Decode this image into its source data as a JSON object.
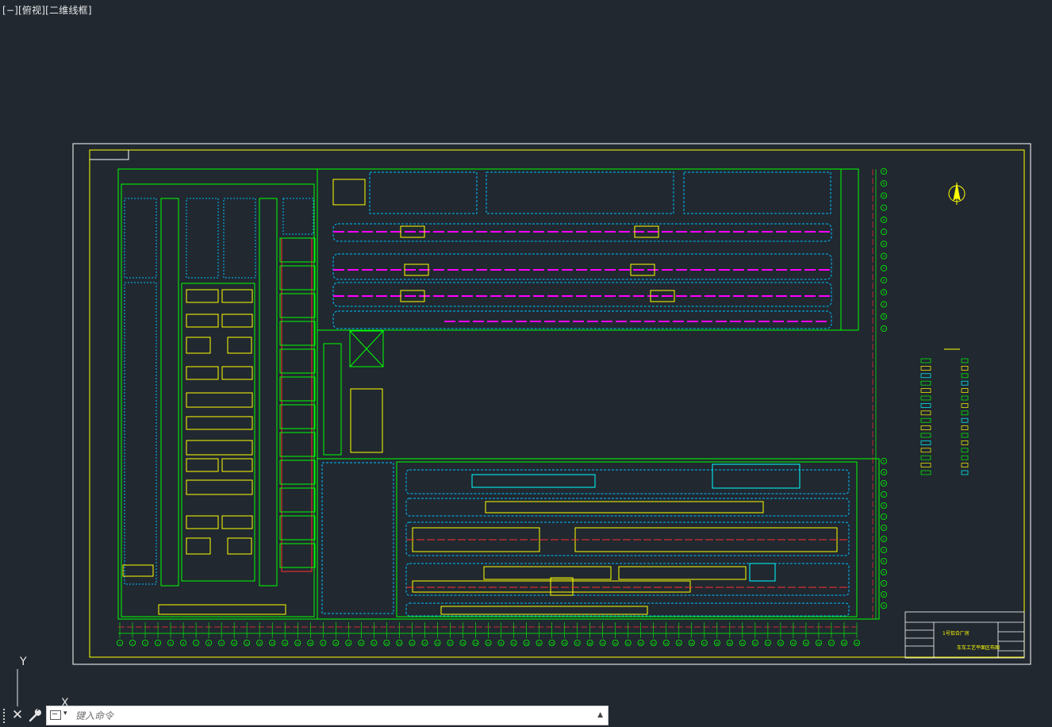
{
  "viewport": {
    "label": "[−][俯视][二维线框]"
  },
  "ucs": {
    "x_label": "X",
    "y_label": "Y"
  },
  "command_line": {
    "placeholder": "键入命令",
    "close_glyph": "✕",
    "up_glyph": "▲",
    "caret_glyph": "▾"
  },
  "drawing": {
    "title_block": {
      "project": "1号铝合厂房",
      "drawing_name": "车车工艺平面区布图"
    },
    "colors": {
      "background": "#212830",
      "sheet_border": "#ffffff",
      "frame": "#ffff00",
      "walls": "#00ff00",
      "dashed": "#00bfff",
      "equipment": "#ffff00",
      "pipes": "#ff00ff",
      "axis": "#ff3030",
      "cyan": "#00ffff"
    },
    "axis_labels_bottom": [
      "1",
      "2",
      "3",
      "4",
      "5",
      "6",
      "7",
      "8",
      "9",
      "10",
      "11",
      "12",
      "13",
      "14",
      "15",
      "16",
      "17",
      "18",
      "19",
      "20",
      "21",
      "22",
      "23",
      "24",
      "25",
      "26",
      "27",
      "28",
      "29",
      "30",
      "31",
      "32",
      "33",
      "34",
      "35",
      "36",
      "37",
      "38",
      "39",
      "40",
      "41",
      "42",
      "43",
      "44",
      "45",
      "46",
      "47",
      "48",
      "49",
      "50",
      "51",
      "52",
      "53",
      "54",
      "55",
      "56",
      "57",
      "58",
      "59"
    ],
    "axis_labels_right": [
      "P",
      "N",
      "M",
      "L",
      "K",
      "J",
      "H",
      "G",
      "F",
      "E",
      "D",
      "C",
      "B",
      "A"
    ]
  }
}
